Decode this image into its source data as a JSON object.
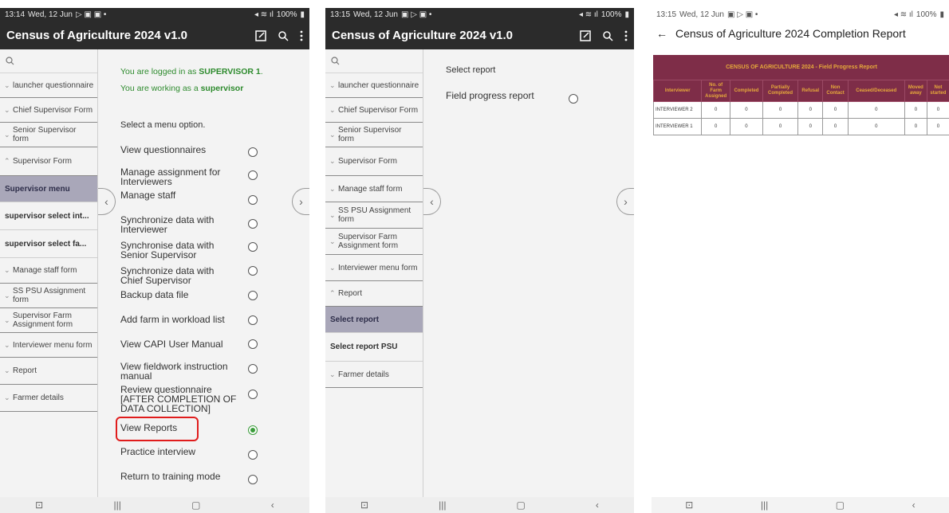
{
  "panel1": {
    "status": {
      "time": "13:14",
      "date": "Wed, 12 Jun",
      "battery": "100%"
    },
    "app_title": "Census of Agriculture 2024 v1.0",
    "sidebar": {
      "items": [
        {
          "label": "launcher questionnaire",
          "chev": "down"
        },
        {
          "label": "Chief Supervisor Form",
          "chev": "down"
        },
        {
          "label": "Senior Supervisor form",
          "chev": "down"
        },
        {
          "label": "Supervisor Form",
          "chev": "up"
        }
      ],
      "sub_items": [
        "Supervisor menu",
        "supervisor select int...",
        "supervisor select fa..."
      ],
      "items_after": [
        {
          "label": "Manage staff form"
        },
        {
          "label": "SS PSU Assignment form"
        },
        {
          "label": "Supervisor Farm Assignment form"
        },
        {
          "label": "Interviewer menu form"
        },
        {
          "label": "Report"
        },
        {
          "label": "Farmer details"
        }
      ]
    },
    "logged_prefix": "You are logged in as ",
    "logged_user": "SUPERVISOR 1",
    "working_prefix": "You are working as a ",
    "working_role": "supervisor",
    "select_prompt": "Select a menu option.",
    "options": [
      "View questionnaires",
      "Manage assignment for Interviewers",
      "Manage staff",
      "Synchronize data with Interviewer",
      "Synchronise data with Senior Supervisor",
      "Synchronize data with Chief Supervisor",
      "Backup data file",
      "Add farm in workload list",
      "View CAPI User Manual",
      "View fieldwork instruction manual",
      "Review questionnaire [AFTER COMPLETION OF DATA COLLECTION]",
      "View Reports",
      "Practice interview",
      "Return to training mode"
    ],
    "selected_option": "View Reports"
  },
  "panel2": {
    "status": {
      "time": "13:15",
      "date": "Wed, 12 Jun",
      "battery": "100%"
    },
    "app_title": "Census of Agriculture 2024 v1.0",
    "sidebar": {
      "items": [
        {
          "label": "launcher questionnaire"
        },
        {
          "label": "Chief Supervisor Form"
        },
        {
          "label": "Senior Supervisor form"
        },
        {
          "label": "Supervisor Form"
        },
        {
          "label": "Manage staff form"
        },
        {
          "label": "SS PSU Assignment form"
        },
        {
          "label": "Supervisor Farm Assignment form"
        },
        {
          "label": "Interviewer menu form"
        },
        {
          "label": "Report"
        }
      ],
      "sub_items": [
        "Select report",
        "Select report PSU"
      ],
      "items_after": [
        {
          "label": "Farmer details"
        }
      ]
    },
    "question": "Select report",
    "option": "Field progress report"
  },
  "panel3": {
    "status": {
      "time": "13:15",
      "date": "Wed, 12 Jun",
      "battery": "100%"
    },
    "title": "Census of Agriculture 2024 Completion Report",
    "banner": "CENSUS OF AGRICULTURE 2024 - Field Progress Report",
    "table": {
      "headers": [
        "Interviewer",
        "No. of Farm Assigned",
        "Completed",
        "Partially Completed",
        "Refusal",
        "Non Contact",
        "Ceased/Deceased",
        "Moved away",
        "Not started"
      ],
      "rows": [
        [
          "INTERVIEWER 2",
          "0",
          "0",
          "0",
          "0",
          "0",
          "0",
          "0",
          "0"
        ],
        [
          "INTERVIEWER 1",
          "0",
          "0",
          "0",
          "0",
          "0",
          "0",
          "0",
          "0"
        ]
      ]
    }
  },
  "colors": {
    "appbar": "#2b2b2b",
    "success_green": "#2e8b2e",
    "highlight_red": "#e01c1c",
    "report_maroon": "#7e2d48",
    "report_gold": "#e6a93b",
    "selected_sidebar": "#a9a7b9"
  }
}
